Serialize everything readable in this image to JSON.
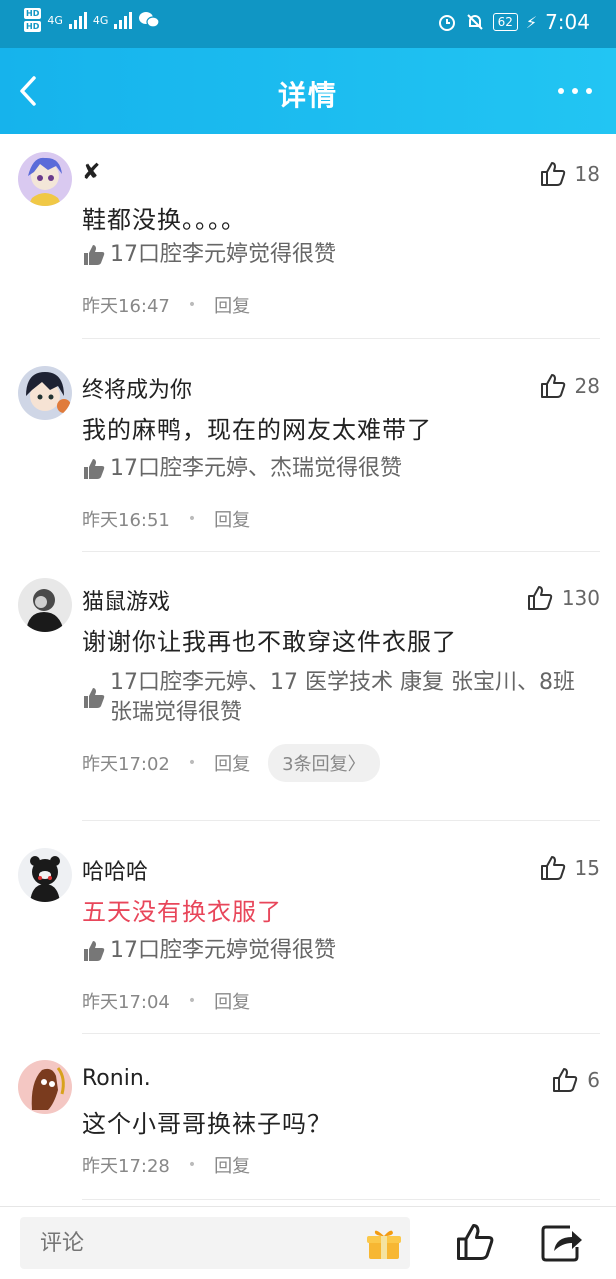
{
  "status_bar": {
    "time": "7:04",
    "battery": "62",
    "network": "4G"
  },
  "header": {
    "title": "详情"
  },
  "comments": [
    {
      "user": "✘",
      "likes": "18",
      "text": "鞋都没换。。。。",
      "liked_by": "17口腔李元婷觉得很赞",
      "time": "昨天16:47",
      "reply": "回复"
    },
    {
      "user": "终将成为你",
      "likes": "28",
      "text": "我的麻鸭，现在的网友太难带了",
      "liked_by": "17口腔李元婷、杰瑞觉得很赞",
      "time": "昨天16:51",
      "reply": "回复"
    },
    {
      "user": "猫鼠游戏",
      "likes": "130",
      "text": "谢谢你让我再也不敢穿这件衣服了",
      "liked_by": "17口腔李元婷、17 医学技术 康复 张宝川、8班张瑞觉得很赞",
      "time": "昨天17:02",
      "reply": "回复",
      "replies_count": "3条回复"
    },
    {
      "user": "哈哈哈",
      "likes": "15",
      "text": "五天没有换衣服了",
      "liked_by": "17口腔李元婷觉得很赞",
      "time": "昨天17:04",
      "reply": "回复"
    },
    {
      "user": "Ronin.",
      "likes": "6",
      "text": "这个小哥哥换袜子吗？",
      "time": "昨天17:28",
      "reply": "回复"
    }
  ],
  "bottom_bar": {
    "comment_placeholder": "评论"
  }
}
